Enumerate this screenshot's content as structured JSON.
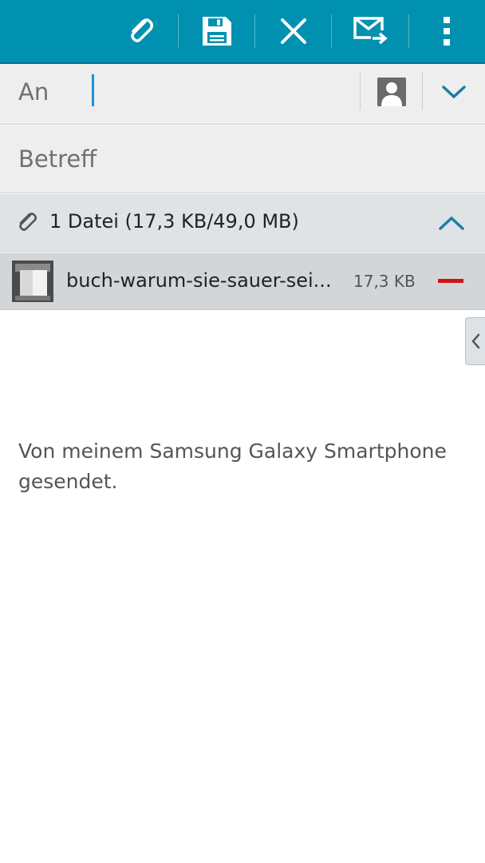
{
  "toolbar": {
    "icons": [
      "paperclip-icon",
      "save-icon",
      "close-icon",
      "send-icon",
      "more-vert-icon"
    ],
    "color": "#0090b0"
  },
  "to_field": {
    "label": "An",
    "value": ""
  },
  "subject_field": {
    "placeholder": "Betreff"
  },
  "attachments": {
    "summary": "1 Datei (17,3 KB/49,0 MB)",
    "items": [
      {
        "name": "buch-warum-sie-sauer-sei...",
        "size": "17,3 KB"
      }
    ],
    "remove_color": "#d21414"
  },
  "body": {
    "signature": "Von meinem Samsung Galaxy Smartphone gesendet."
  }
}
